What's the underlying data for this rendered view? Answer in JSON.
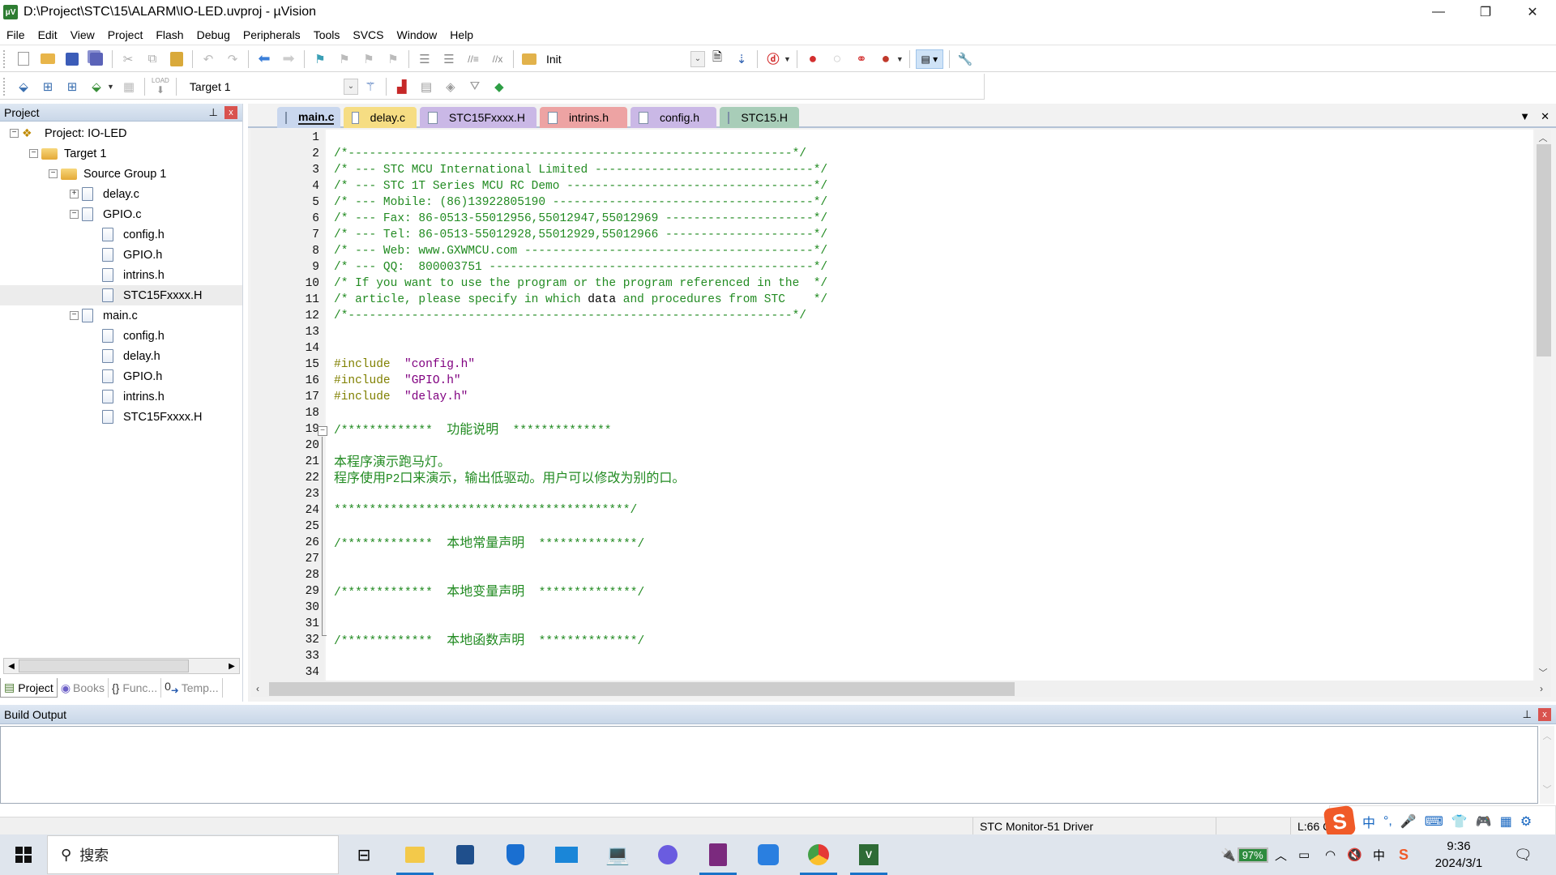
{
  "window": {
    "title": "D:\\Project\\STC\\15\\ALARM\\IO-LED.uvproj - µVision",
    "app_icon": "uvision-icon",
    "controls": {
      "minimize": "—",
      "restore": "❐",
      "close": "✕"
    }
  },
  "menu": [
    "File",
    "Edit",
    "View",
    "Project",
    "Flash",
    "Debug",
    "Peripherals",
    "Tools",
    "SVCS",
    "Window",
    "Help"
  ],
  "toolbar1": {
    "find_combo_value": "Init"
  },
  "toolbar2": {
    "target_combo_value": "Target 1",
    "load_label": "LOAD"
  },
  "project_panel": {
    "title": "Project",
    "pin": "📌",
    "close": "x",
    "tree": [
      {
        "label": "Project: IO-LED",
        "level": 0,
        "type": "project",
        "expander": "−"
      },
      {
        "label": "Target 1",
        "level": 1,
        "type": "target",
        "expander": "−"
      },
      {
        "label": "Source Group 1",
        "level": 2,
        "type": "folder",
        "expander": "−"
      },
      {
        "label": "delay.c",
        "level": 3,
        "type": "cfile",
        "expander": "+"
      },
      {
        "label": "GPIO.c",
        "level": 3,
        "type": "cfile",
        "expander": "−"
      },
      {
        "label": "config.h",
        "level": 4,
        "type": "hfile"
      },
      {
        "label": "GPIO.h",
        "level": 4,
        "type": "hfile"
      },
      {
        "label": "intrins.h",
        "level": 4,
        "type": "hfile"
      },
      {
        "label": "STC15Fxxxx.H",
        "level": 4,
        "type": "hfile",
        "selected": true
      },
      {
        "label": "main.c",
        "level": 3,
        "type": "cfile",
        "expander": "−"
      },
      {
        "label": "config.h",
        "level": 4,
        "type": "hfile"
      },
      {
        "label": "delay.h",
        "level": 4,
        "type": "hfile"
      },
      {
        "label": "GPIO.h",
        "level": 4,
        "type": "hfile"
      },
      {
        "label": "intrins.h",
        "level": 4,
        "type": "hfile"
      },
      {
        "label": "STC15Fxxxx.H",
        "level": 4,
        "type": "hfile"
      }
    ],
    "bottom_tabs": [
      {
        "label": "Project",
        "active": true
      },
      {
        "label": "Books"
      },
      {
        "label": "Func..."
      },
      {
        "label": "Temp..."
      }
    ]
  },
  "editor": {
    "tabs": [
      {
        "label": "main.c",
        "color": "#c9d7ee",
        "active": true
      },
      {
        "label": "delay.c",
        "color": "#f6dd83"
      },
      {
        "label": "STC15Fxxxx.H",
        "color": "#cab8e6"
      },
      {
        "label": "intrins.h",
        "color": "#eda3a3"
      },
      {
        "label": "config.h",
        "color": "#cab8e6"
      },
      {
        "label": "STC15.H",
        "color": "#a8cdb8"
      }
    ],
    "tab_menu": "▼",
    "tab_close": "✕",
    "lines": [
      {
        "n": 1,
        "segs": []
      },
      {
        "n": 2,
        "segs": [
          {
            "t": "/*---------------------------------------------------------------*/",
            "c": "cm"
          }
        ]
      },
      {
        "n": 3,
        "segs": [
          {
            "t": "/* --- STC MCU International Limited -------------------------------*/",
            "c": "cm"
          }
        ]
      },
      {
        "n": 4,
        "segs": [
          {
            "t": "/* --- STC 1T Series MCU RC Demo -----------------------------------*/",
            "c": "cm"
          }
        ]
      },
      {
        "n": 5,
        "segs": [
          {
            "t": "/* --- Mobile: (86)13922805190 -------------------------------------*/",
            "c": "cm"
          }
        ]
      },
      {
        "n": 6,
        "segs": [
          {
            "t": "/* --- Fax: 86-0513-55012956,55012947,55012969 ---------------------*/",
            "c": "cm"
          }
        ]
      },
      {
        "n": 7,
        "segs": [
          {
            "t": "/* --- Tel: 86-0513-55012928,55012929,55012966 ---------------------*/",
            "c": "cm"
          }
        ]
      },
      {
        "n": 8,
        "segs": [
          {
            "t": "/* --- Web: www.GXWMCU.com -----------------------------------------*/",
            "c": "cm"
          }
        ]
      },
      {
        "n": 9,
        "segs": [
          {
            "t": "/* --- QQ:  800003751 ----------------------------------------------*/",
            "c": "cm"
          }
        ]
      },
      {
        "n": 10,
        "segs": [
          {
            "t": "/* If you want to use the program or the program referenced in the  */",
            "c": "cm"
          }
        ]
      },
      {
        "n": 11,
        "segs": [
          {
            "t": "/* article, please specify in which ",
            "c": "cm"
          },
          {
            "t": "data",
            "c": "kw"
          },
          {
            "t": " and procedures from STC    */",
            "c": "cm"
          }
        ]
      },
      {
        "n": 12,
        "segs": [
          {
            "t": "/*---------------------------------------------------------------*/",
            "c": "cm"
          }
        ]
      },
      {
        "n": 13,
        "segs": []
      },
      {
        "n": 14,
        "segs": []
      },
      {
        "n": 15,
        "segs": [
          {
            "t": "#include  ",
            "c": "pp"
          },
          {
            "t": "\"config.h\"",
            "c": "str"
          }
        ]
      },
      {
        "n": 16,
        "segs": [
          {
            "t": "#include  ",
            "c": "pp"
          },
          {
            "t": "\"GPIO.h\"",
            "c": "str"
          }
        ]
      },
      {
        "n": 17,
        "segs": [
          {
            "t": "#include  ",
            "c": "pp"
          },
          {
            "t": "\"delay.h\"",
            "c": "str"
          }
        ]
      },
      {
        "n": 18,
        "segs": []
      },
      {
        "n": 19,
        "segs": [
          {
            "t": "/*************  ",
            "c": "cm"
          },
          {
            "t": "功能说明",
            "c": "cn"
          },
          {
            "t": "  **************",
            "c": "cm"
          }
        ]
      },
      {
        "n": 20,
        "segs": []
      },
      {
        "n": 21,
        "segs": [
          {
            "t": "本程序演示跑马灯。",
            "c": "cn"
          }
        ]
      },
      {
        "n": 22,
        "segs": [
          {
            "t": "程序使用",
            "c": "cn"
          },
          {
            "t": "P2",
            "c": "cm"
          },
          {
            "t": "口来演示，输出低驱动。用户可以修改为别的口。",
            "c": "cn"
          }
        ]
      },
      {
        "n": 23,
        "segs": []
      },
      {
        "n": 24,
        "segs": [
          {
            "t": "******************************************/",
            "c": "cm"
          }
        ]
      },
      {
        "n": 25,
        "segs": []
      },
      {
        "n": 26,
        "segs": [
          {
            "t": "/*************  ",
            "c": "cm"
          },
          {
            "t": "本地常量声明",
            "c": "cn"
          },
          {
            "t": "  **************/",
            "c": "cm"
          }
        ]
      },
      {
        "n": 27,
        "segs": []
      },
      {
        "n": 28,
        "segs": []
      },
      {
        "n": 29,
        "segs": [
          {
            "t": "/*************  ",
            "c": "cm"
          },
          {
            "t": "本地变量声明",
            "c": "cn"
          },
          {
            "t": "  **************/",
            "c": "cm"
          }
        ]
      },
      {
        "n": 30,
        "segs": []
      },
      {
        "n": 31,
        "segs": []
      },
      {
        "n": 32,
        "segs": [
          {
            "t": "/*************  ",
            "c": "cm"
          },
          {
            "t": "本地函数声明",
            "c": "cn"
          },
          {
            "t": "  **************/",
            "c": "cm"
          }
        ]
      },
      {
        "n": 33,
        "segs": []
      },
      {
        "n": 34,
        "segs": []
      }
    ]
  },
  "build_output": {
    "title": "Build Output",
    "content": ""
  },
  "statusbar": {
    "driver": "STC Monitor-51 Driver",
    "position": "L:66 C"
  },
  "ime": {
    "icons": [
      "中",
      "°,",
      "🎤",
      "⌨",
      "👕",
      "🎮",
      "▦",
      "⚙"
    ]
  },
  "taskbar": {
    "search_placeholder": "搜索",
    "battery": "97%",
    "time": "9:36",
    "date": "2024/3/1",
    "ime_indicator": "中"
  },
  "colors": {
    "comment": "#228b22",
    "preprocessor": "#808000",
    "string": "#800080",
    "keyword": "#000000",
    "panel_header": "#c9d7e8",
    "taskbar_active": "#1a73c8"
  }
}
